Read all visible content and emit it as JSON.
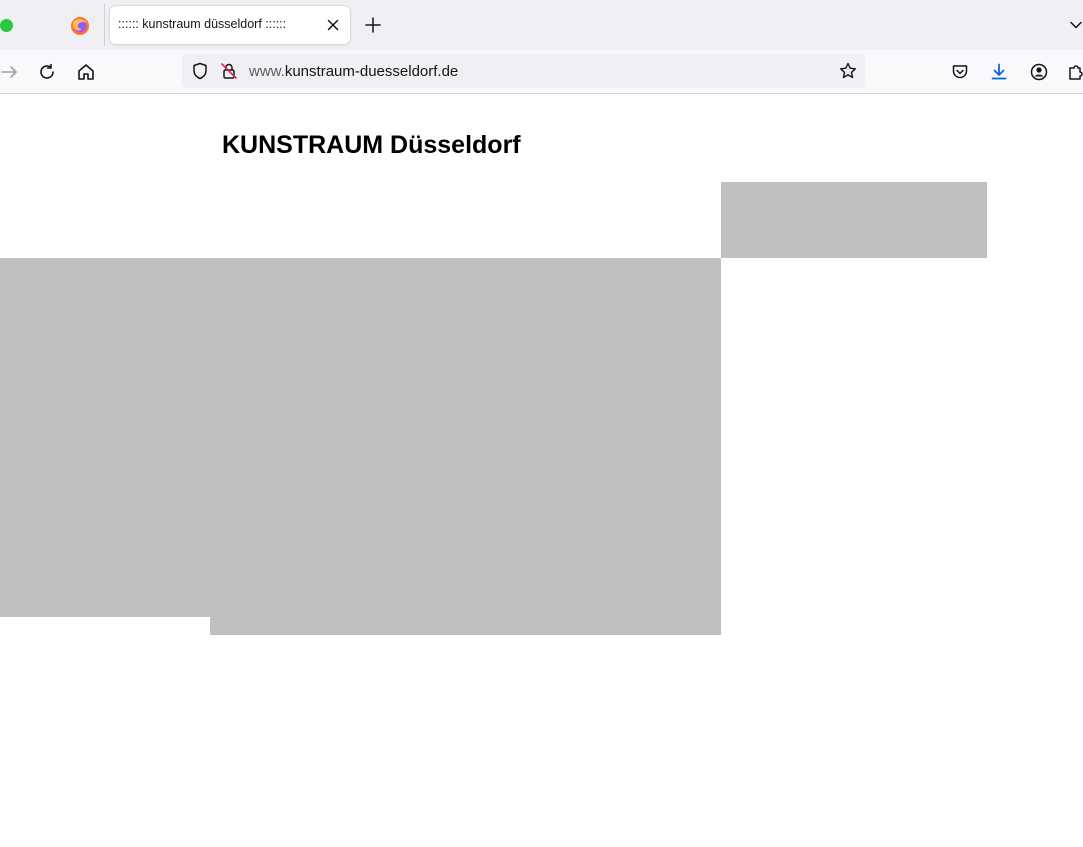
{
  "browser": {
    "tab": {
      "title": ":::::: kunstraum düsseldorf ::::::",
      "icon": "firefox-icon"
    },
    "url": {
      "prefix": "www.",
      "domain": "kunstraum-duesseldorf.de"
    },
    "colors": {
      "tabstrip": "#f0f0f4",
      "navbar": "#f9f9fb",
      "downloads_accent": "#0061e0",
      "traffic_light_green": "#28c840"
    }
  },
  "page": {
    "title": "KUNSTRAUM Düsseldorf",
    "placeholder_color": "#bfbfbf"
  }
}
